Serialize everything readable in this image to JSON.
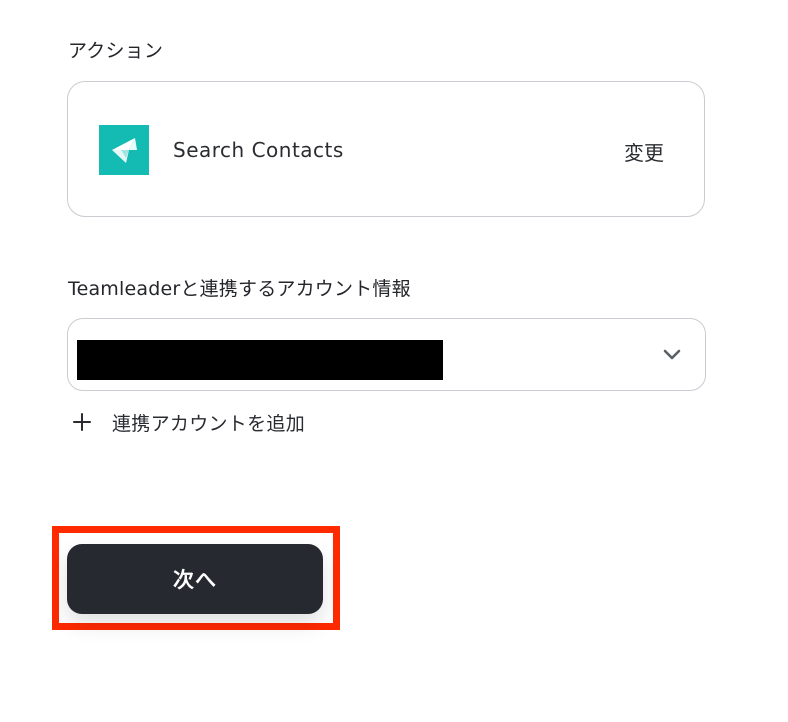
{
  "action_section": {
    "label": "アクション",
    "action_name": "Search Contacts",
    "change_label": "変更",
    "app_icon": "teamleader-logo-icon",
    "app_icon_color": "#13bbb2"
  },
  "account_section": {
    "label": "Teamleaderと連携するアカウント情報",
    "selected_value": "",
    "redacted": true,
    "add_account_label": "連携アカウントを追加"
  },
  "footer": {
    "next_label": "次へ",
    "highlight_color": "#ff2a00",
    "button_color": "#262930"
  }
}
